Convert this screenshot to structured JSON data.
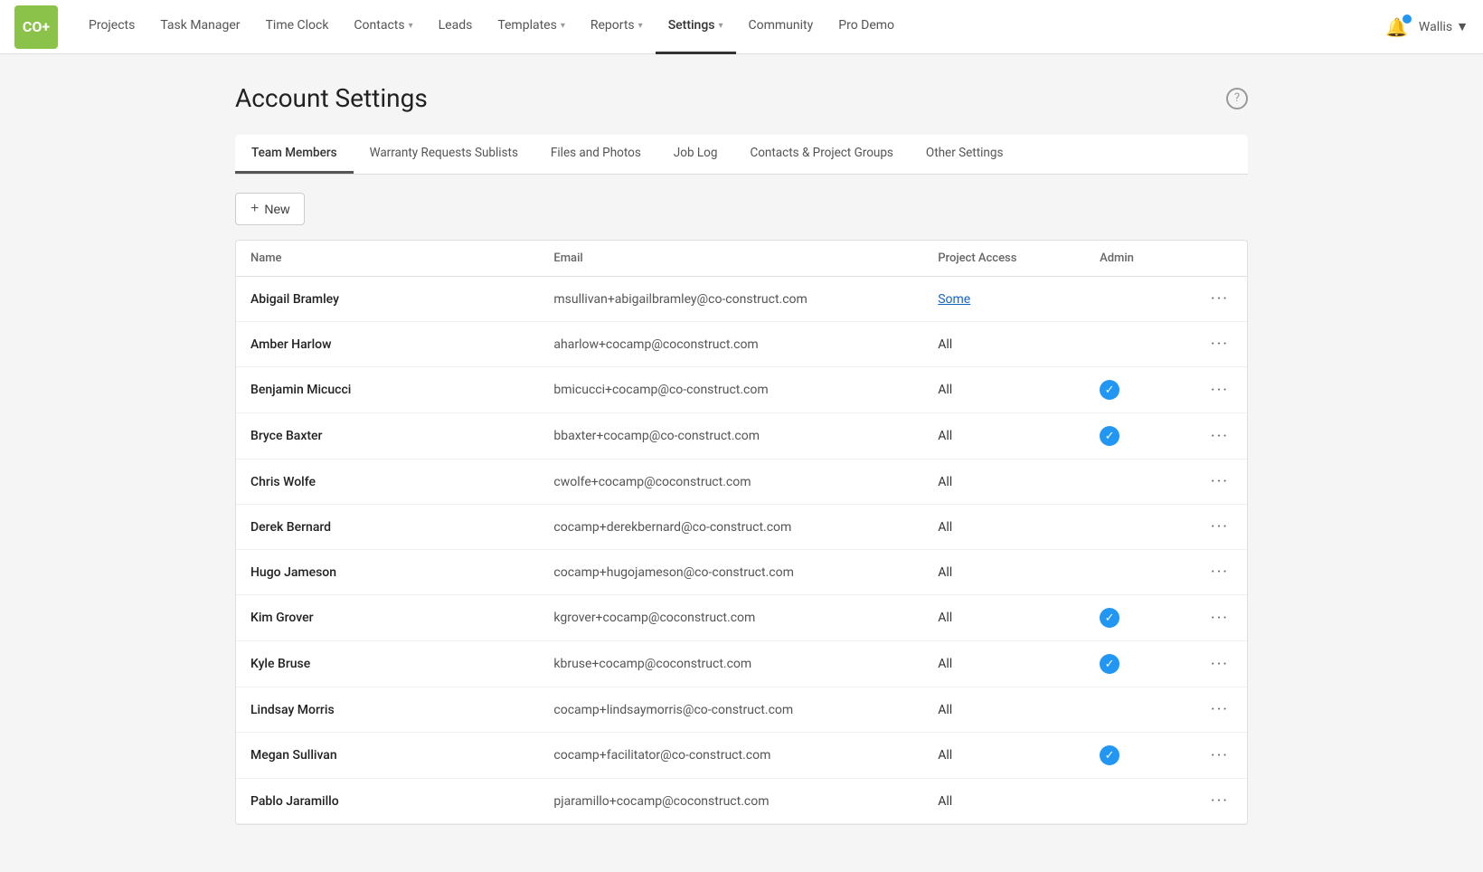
{
  "logo": "CO+",
  "nav": {
    "items": [
      {
        "label": "Projects",
        "active": false,
        "dropdown": false
      },
      {
        "label": "Task Manager",
        "active": false,
        "dropdown": false
      },
      {
        "label": "Time Clock",
        "active": false,
        "dropdown": false
      },
      {
        "label": "Contacts",
        "active": false,
        "dropdown": true
      },
      {
        "label": "Leads",
        "active": false,
        "dropdown": false
      },
      {
        "label": "Templates",
        "active": false,
        "dropdown": true
      },
      {
        "label": "Reports",
        "active": false,
        "dropdown": true
      },
      {
        "label": "Settings",
        "active": true,
        "dropdown": true
      },
      {
        "label": "Community",
        "active": false,
        "dropdown": false
      },
      {
        "label": "Pro Demo",
        "active": false,
        "dropdown": false
      }
    ],
    "user_label": "Wallis",
    "bell_label": "🔔"
  },
  "page": {
    "title": "Account Settings",
    "help_icon": "?"
  },
  "tabs": [
    {
      "label": "Team Members",
      "active": true
    },
    {
      "label": "Warranty Requests Sublists",
      "active": false
    },
    {
      "label": "Files and Photos",
      "active": false
    },
    {
      "label": "Job Log",
      "active": false
    },
    {
      "label": "Contacts & Project Groups",
      "active": false
    },
    {
      "label": "Other Settings",
      "active": false
    }
  ],
  "new_button": "+ New",
  "table": {
    "headers": [
      "Name",
      "Email",
      "Project Access",
      "Admin"
    ],
    "rows": [
      {
        "name": "Abigail Bramley",
        "email": "msullivan+abigailbramley@co-construct.com",
        "access": "Some",
        "access_type": "some",
        "admin": false
      },
      {
        "name": "Amber Harlow",
        "email": "aharlow+cocamp@coconstruct.com",
        "access": "All",
        "access_type": "all",
        "admin": false
      },
      {
        "name": "Benjamin Micucci",
        "email": "bmicucci+cocamp@co-construct.com",
        "access": "All",
        "access_type": "all",
        "admin": true
      },
      {
        "name": "Bryce Baxter",
        "email": "bbaxter+cocamp@co-construct.com",
        "access": "All",
        "access_type": "all",
        "admin": true
      },
      {
        "name": "Chris Wolfe",
        "email": "cwolfe+cocamp@coconstruct.com",
        "access": "All",
        "access_type": "all",
        "admin": false
      },
      {
        "name": "Derek Bernard",
        "email": "cocamp+derekbernard@co-construct.com",
        "access": "All",
        "access_type": "all",
        "admin": false
      },
      {
        "name": "Hugo Jameson",
        "email": "cocamp+hugojameson@co-construct.com",
        "access": "All",
        "access_type": "all",
        "admin": false
      },
      {
        "name": "Kim Grover",
        "email": "kgrover+cocamp@coconstruct.com",
        "access": "All",
        "access_type": "all",
        "admin": true
      },
      {
        "name": "Kyle Bruse",
        "email": "kbruse+cocamp@coconstruct.com",
        "access": "All",
        "access_type": "all",
        "admin": true
      },
      {
        "name": "Lindsay Morris",
        "email": "cocamp+lindsaymorris@co-construct.com",
        "access": "All",
        "access_type": "all",
        "admin": false
      },
      {
        "name": "Megan Sullivan",
        "email": "cocamp+facilitator@co-construct.com",
        "access": "All",
        "access_type": "all",
        "admin": true
      },
      {
        "name": "Pablo Jaramillo",
        "email": "pjaramillo+cocamp@coconstruct.com",
        "access": "All",
        "access_type": "all",
        "admin": false
      }
    ]
  }
}
